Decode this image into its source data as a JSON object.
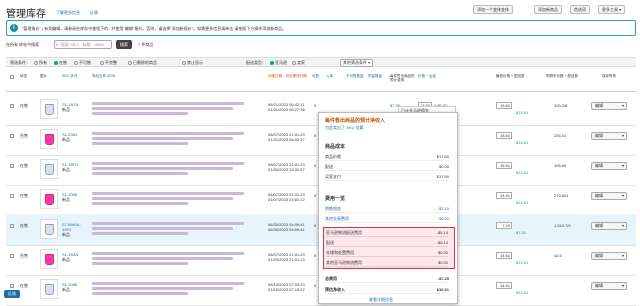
{
  "header": {
    "title": "管理库存",
    "learn_more": "了解更多信息",
    "feedback": "反馈",
    "add_variation": "添加一个变体变体",
    "add_product": "添加新商品",
    "preferences": "首选项",
    "more": "更多工具 ▾"
  },
  "banner": {
    "text": "\"管理报价\" | 有关编辑，请参阅在库存中查找下的...并使用\"编辑\"报价。否则，请选择\"添加新报价\"。如需更多信息请单击 请按照下方操作添加新商品。"
  },
  "search": {
    "label": "在所有 库存中搜索",
    "placeholder": "搜索 SKU、标题、ISBN",
    "button": "搜索",
    "count": "7 件商品"
  },
  "filters": {
    "label": "筛选条件：",
    "status_all": "所有",
    "active": "在售",
    "inactive": "不可售",
    "incomplete": "不完整",
    "listing_removed": "已删除的商品",
    "suppressed": "禁止显示",
    "fulfilled_by": "配送类型：",
    "fba": "亚马逊",
    "merchant": "卖家",
    "more": "其他筛选条件 ▾"
  },
  "columns": {
    "status": "状态",
    "image": "图片",
    "sku": "SKU 状况",
    "title": "商品名称 ASIN",
    "date": "创建日期 ↓ 状态更改日期",
    "available": "可售",
    "inbound": "入库",
    "unfulfillable": "不可售数量",
    "reserved": "预留数量",
    "fee": "每件售出商品的预计费用",
    "price": "价格 + 运费",
    "lowest": "最低价格 + 配送费",
    "buybox": "购物车价格 + 配送费",
    "save": "保存所有"
  },
  "rows": [
    {
      "status": "在售",
      "sku": "S1-1N7A",
      "cond": "新品",
      "date1": "06/21/2023 06:42:11",
      "date2": "01/31/2023 06:27:36",
      "avail": "0",
      "fee": "$7.36",
      "price": "17.60",
      "price2": "+ $0.00",
      "buy": "15.61",
      "buy2": "$15.61",
      "low": "100.2/6",
      "action": "编辑"
    },
    {
      "status": "在售",
      "sku": "S1-2084",
      "cond": "新品",
      "date1": "06/07/2023 21:01:23",
      "date2": "01/31/2023 06:02:37",
      "avail": "0",
      "fee": "",
      "price": "",
      "price2": "",
      "buy": "18.61",
      "buy2": "$18.61",
      "low": "226.31",
      "action": "编辑"
    },
    {
      "status": "在售",
      "sku": "S1-3RR1",
      "cond": "新品",
      "date1": "06/07/2023 21:01:23",
      "date2": "01/30/2023 19:32:57",
      "avail": "0",
      "fee": "",
      "price": "",
      "price2": "",
      "buy": "15.61",
      "buy2": "$15.61",
      "low": "195.60",
      "action": "编辑"
    },
    {
      "status": "在售",
      "sku": "S1-2088",
      "cond": "新品",
      "date1": "06/07/2023 21:01:23",
      "date2": "01/07/2023 23:01:22",
      "avail": "0",
      "fee": "",
      "price": "",
      "price2": "",
      "buy": "14.61",
      "buy2": "$14.61",
      "low": "270.824",
      "action": "编辑"
    },
    {
      "status": "在售",
      "sku": "S7-BW0A-19E4",
      "cond": "新品",
      "date1": "06/30/2023 04:09:41",
      "date2": "06/30/2023 04:09:41",
      "avail": "0",
      "fee": "",
      "price": "",
      "price2": "",
      "buy": "7.20",
      "buy2": "$7.20",
      "low": "1,510.7/0",
      "action": "编辑"
    },
    {
      "status": "在售",
      "sku": "S1-1K8A",
      "cond": "新品",
      "date1": "06/07/2023 21:01:23",
      "date2": "01/29/2023 21:01:23",
      "avail": "0",
      "fee": "",
      "price": "",
      "price2": "",
      "buy": "14.61",
      "buy2": "$14.61",
      "low": "42.6",
      "action": "编辑"
    },
    {
      "status": "在售",
      "sku": "S1-2088",
      "cond": "新品",
      "date1": "06/14/2023 07:03:23",
      "date2": "01/10/2023 07:15:22",
      "avail": "0",
      "fee": "",
      "price": "",
      "price2": "",
      "buy": "14.61",
      "buy2": "$14.61",
      "low": "",
      "action": "编辑"
    }
  ],
  "tooltip": {
    "line1": "已计亚马逊佣金",
    "line2": "✔ 已应用价格"
  },
  "popup": {
    "title": "每件售出商品的预计净收入",
    "subtitle": "为此卖出了 SKU 估算",
    "cost_title": "商品成本",
    "cost_rows": [
      {
        "k": "商品价格",
        "v": "$17.90"
      },
      {
        "k": "配送",
        "v": "$0.00"
      },
      {
        "k": "买家支付",
        "v": "$17.90"
      }
    ],
    "fee_title": "费用一览",
    "fee_rows": [
      {
        "k": "销售佣金",
        "v": "-$2.15"
      },
      {
        "k": "其他交易费用",
        "v": "$0.00"
      }
    ],
    "red_rows": [
      {
        "k": "亚马逊物流配送费用",
        "v": "-$5.14"
      },
      {
        "k": "配送",
        "v": "-$5.14"
      },
      {
        "k": "仓储和处置费用",
        "v": "$0.00"
      },
      {
        "k": "其他亚马逊物流费用",
        "v": "$0.00"
      }
    ],
    "total_k": "总费用",
    "total_v": "-$7.29",
    "net_k": "预估净收入",
    "net_v": "$10.61",
    "link": "查看详细信息"
  },
  "footer_tag": "反馈"
}
